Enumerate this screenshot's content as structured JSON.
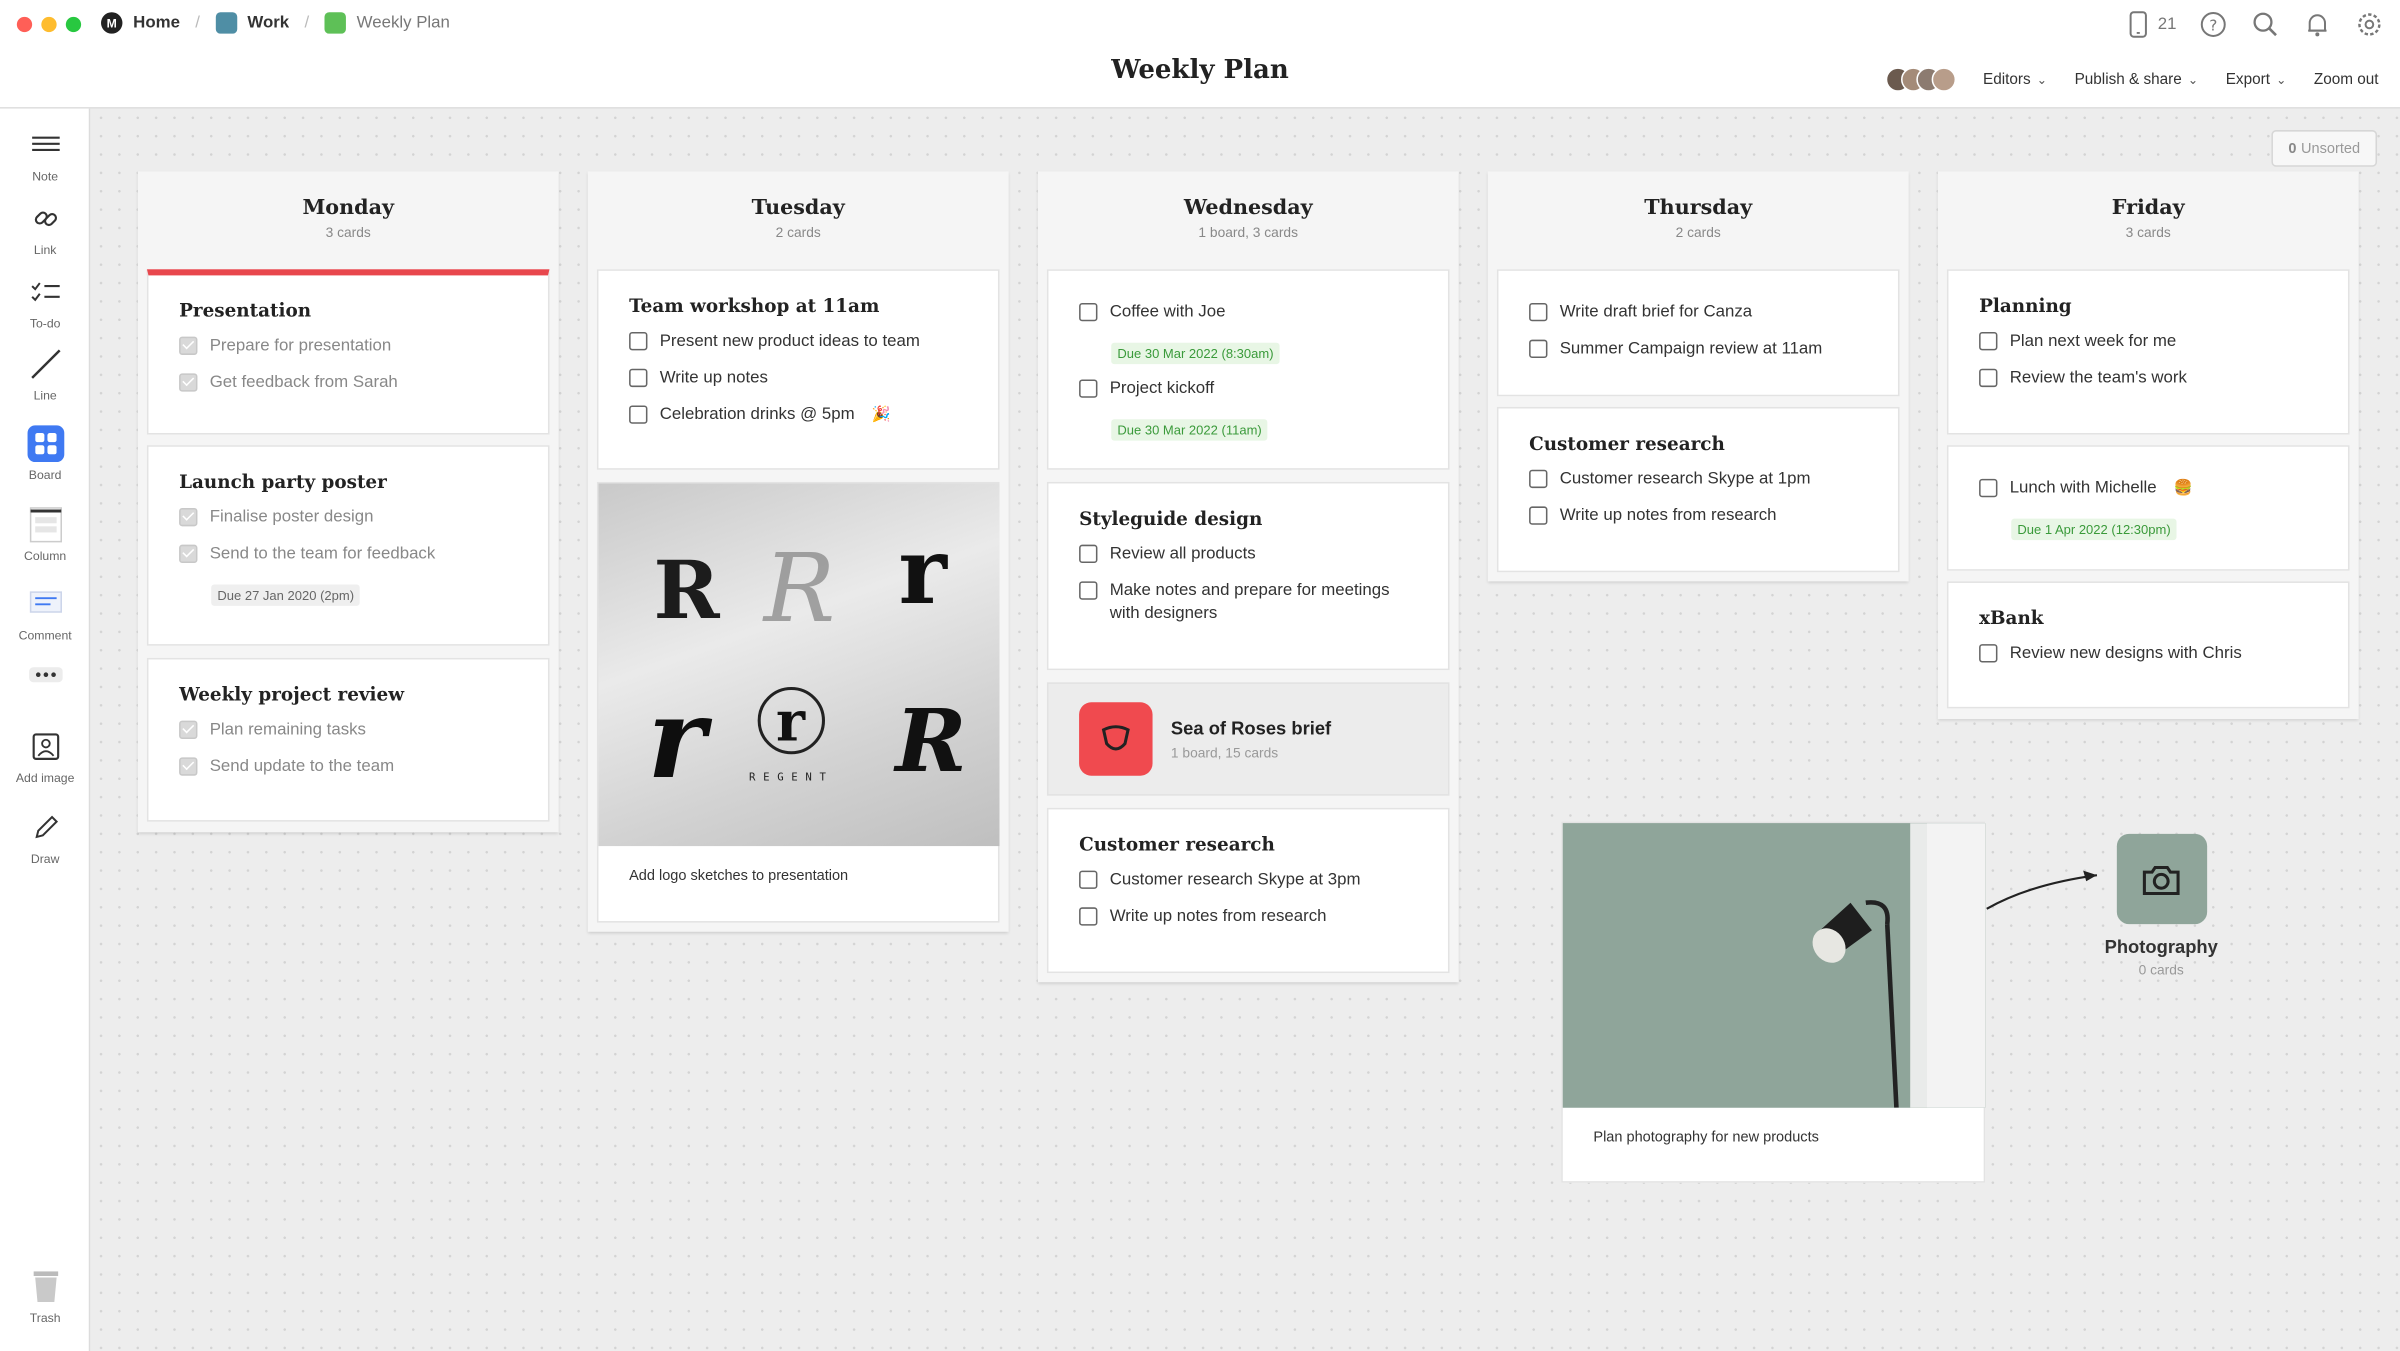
{
  "breadcrumb": {
    "home": "Home",
    "work": "Work",
    "current": "Weekly Plan"
  },
  "page": {
    "title": "Weekly Plan"
  },
  "topbar": {
    "device_count": "21"
  },
  "menu": {
    "editors": "Editors",
    "publish": "Publish & share",
    "export": "Export",
    "zoom": "Zoom out"
  },
  "toolbar": {
    "note": "Note",
    "link": "Link",
    "todo": "To-do",
    "line": "Line",
    "board": "Board",
    "column": "Column",
    "comment": "Comment",
    "add_image": "Add image",
    "draw": "Draw",
    "trash": "Trash"
  },
  "unsorted": {
    "count": "0",
    "label": "Unsorted"
  },
  "columns": {
    "monday": {
      "title": "Monday",
      "count": "3 cards",
      "cards": [
        {
          "title": "Presentation",
          "items": [
            "Prepare for presentation",
            "Get feedback from Sarah"
          ]
        },
        {
          "title": "Launch party poster",
          "items": [
            "Finalise poster design",
            "Send to the team for feedback"
          ],
          "due": "Due 27 Jan 2020 (2pm)"
        },
        {
          "title": "Weekly project review",
          "items": [
            "Plan remaining tasks",
            "Send update to the team"
          ]
        }
      ]
    },
    "tuesday": {
      "title": "Tuesday",
      "count": "2 cards",
      "cards": [
        {
          "title": "Team workshop at 11am",
          "items": [
            "Present new product ideas to team",
            "Write up notes",
            "Celebration drinks @ 5pm"
          ]
        }
      ],
      "image_caption": "Add logo sketches to presentation",
      "sketch_letters": [
        "R",
        "R",
        "r",
        "r",
        "r",
        "R"
      ],
      "sketch_word": "REGENT"
    },
    "wednesday": {
      "title": "Wednesday",
      "count": "1 board, 3 cards",
      "cards": [
        {
          "items": [
            "Coffee with Joe",
            "Project kickoff"
          ],
          "dues": [
            "Due 30 Mar 2022 (8:30am)",
            "Due 30 Mar 2022 (11am)"
          ]
        },
        {
          "title": "Styleguide design",
          "items": [
            "Review all products",
            "Make notes and prepare for meetings with designers"
          ]
        },
        {
          "title": "Customer research",
          "items": [
            "Customer research Skype at 3pm",
            "Write up notes from research"
          ]
        }
      ],
      "board": {
        "name": "Sea of Roses brief",
        "count": "1 board, 15 cards"
      }
    },
    "thursday": {
      "title": "Thursday",
      "count": "2 cards",
      "cards": [
        {
          "items": [
            "Write draft brief for Canza",
            "Summer Campaign review at 11am"
          ]
        },
        {
          "title": "Customer research",
          "items": [
            "Customer research Skype at 1pm",
            "Write up notes from research"
          ]
        }
      ]
    },
    "friday": {
      "title": "Friday",
      "count": "3 cards",
      "cards": [
        {
          "title": "Planning",
          "items": [
            "Plan next week for me",
            "Review the team's work"
          ]
        },
        {
          "items": [
            "Lunch with Michelle"
          ],
          "due": "Due 1 Apr 2022 (12:30pm)"
        },
        {
          "title": "xBank",
          "items": [
            "Review new designs with Chris"
          ]
        }
      ]
    }
  },
  "photo_card": {
    "caption": "Plan photography for new products"
  },
  "photo_board": {
    "name": "Photography",
    "count": "0 cards"
  },
  "colors": {
    "accent_red": "#e8474d",
    "board_blue": "#3f79f2",
    "due_green": "#3a9a3a",
    "photo_green": "#8fa59a"
  }
}
